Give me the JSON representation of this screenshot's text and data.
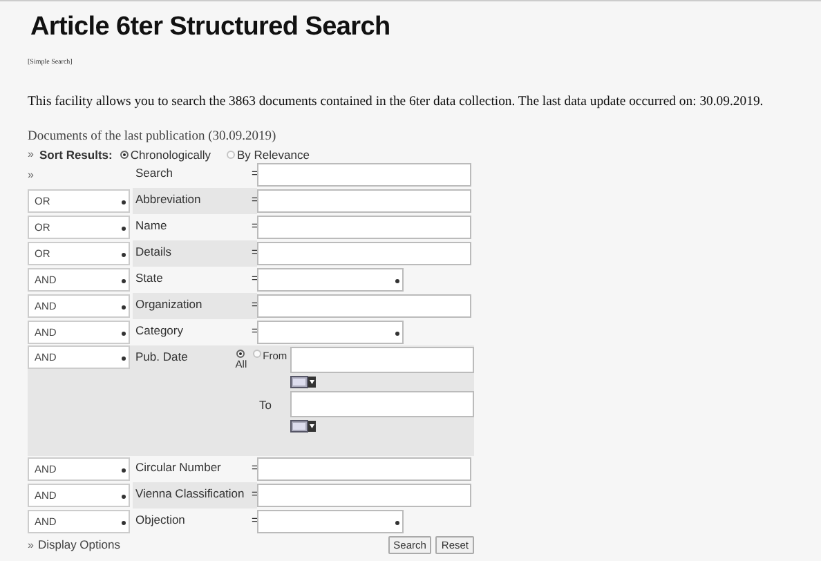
{
  "title": "Article 6ter Structured Search",
  "simple_search_link": "[Simple Search]",
  "intro": "This facility allows you to search the 3863 documents contained in the 6ter data collection. The last data update occurred on: 30.09.2019.",
  "last_publication_link": "Documents of the last publication (30.09.2019)",
  "sort": {
    "label": "Sort Results:",
    "options": [
      {
        "label": "Chronologically",
        "selected": true
      },
      {
        "label": "By Relevance",
        "selected": false
      }
    ]
  },
  "search_marker": "»",
  "rows": [
    {
      "kind": "text",
      "operator": "",
      "label": "Search",
      "equals": "="
    },
    {
      "kind": "text",
      "operator": "OR",
      "label": "Abbreviation",
      "equals": "="
    },
    {
      "kind": "text",
      "operator": "OR",
      "label": "Name",
      "equals": "="
    },
    {
      "kind": "text",
      "operator": "OR",
      "label": "Details",
      "equals": "="
    },
    {
      "kind": "select",
      "operator": "AND",
      "label": "State",
      "equals": "="
    },
    {
      "kind": "text",
      "operator": "AND",
      "label": "Organization",
      "equals": "="
    },
    {
      "kind": "select",
      "operator": "AND",
      "label": "Category",
      "equals": "="
    },
    {
      "kind": "date",
      "operator": "AND",
      "label": "Pub. Date",
      "options": [
        {
          "label": "All",
          "selected": true
        },
        {
          "label": "From",
          "selected": false
        }
      ],
      "to_label": "To"
    },
    {
      "kind": "text",
      "operator": "AND",
      "label": "Circular Number",
      "equals": "="
    },
    {
      "kind": "text",
      "operator": "AND",
      "label": "Vienna Classification",
      "equals": "="
    },
    {
      "kind": "select",
      "operator": "AND",
      "label": "Objection",
      "equals": "="
    }
  ],
  "display_options_link": "Display Options",
  "display_marker": "»",
  "buttons": [
    "Search",
    "Reset"
  ]
}
